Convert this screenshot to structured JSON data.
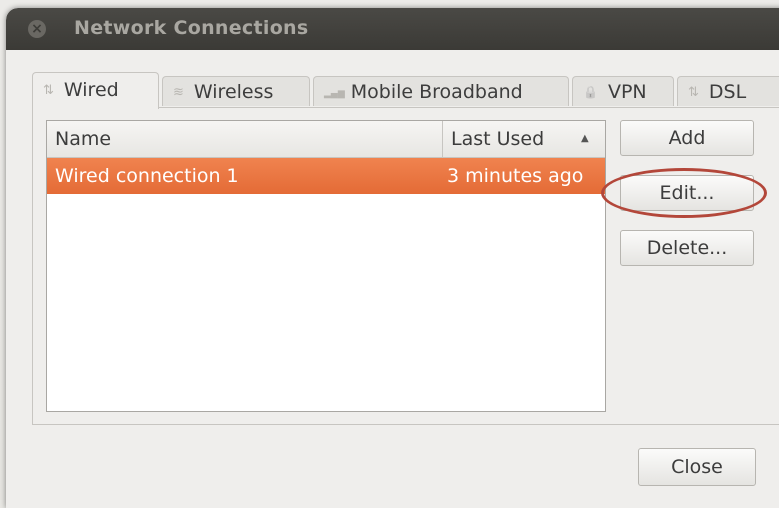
{
  "window": {
    "title": "Network Connections",
    "close_glyph": "×"
  },
  "tabs": [
    {
      "label": "Wired",
      "icon": "wired-network-icon",
      "icon_glyph": "⇅",
      "active": true
    },
    {
      "label": "Wireless",
      "icon": "wireless-icon",
      "icon_glyph": "≋",
      "active": false
    },
    {
      "label": "Mobile Broadband",
      "icon": "signal-bars-icon",
      "icon_glyph": "▂▄▆",
      "active": false
    },
    {
      "label": "VPN",
      "icon": "lock-icon",
      "icon_glyph": "🔒",
      "active": false
    },
    {
      "label": "DSL",
      "icon": "dsl-icon",
      "icon_glyph": "⇅",
      "active": false
    }
  ],
  "list": {
    "columns": [
      "Name",
      "Last Used"
    ],
    "sort_indicator": "▲",
    "rows": [
      {
        "name": "Wired connection 1",
        "last_used": "3 minutes ago",
        "selected": true
      }
    ]
  },
  "buttons": {
    "add": "Add",
    "edit": "Edit...",
    "delete": "Delete...",
    "close": "Close"
  },
  "colors": {
    "selection": "#e46b36",
    "titlebar": "#3c3b37",
    "annotation": "#b3473a"
  }
}
